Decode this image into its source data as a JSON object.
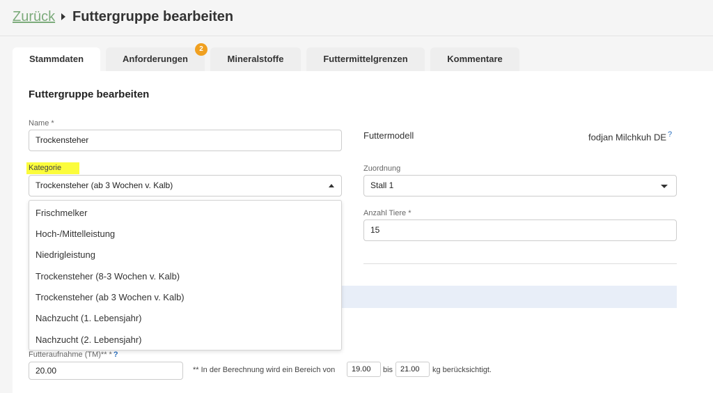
{
  "header": {
    "back_label": "Zurück",
    "title": "Futtergruppe bearbeiten"
  },
  "tabs": [
    {
      "label": "Stammdaten",
      "active": true
    },
    {
      "label": "Anforderungen",
      "badge": "2"
    },
    {
      "label": "Mineralstoffe"
    },
    {
      "label": "Futtermittelgrenzen"
    },
    {
      "label": "Kommentare"
    }
  ],
  "form": {
    "section_title": "Futtergruppe bearbeiten",
    "name_label": "Name *",
    "name_value": "Trockensteher",
    "futtermodell_label": "Futtermodell",
    "futtermodell_value": "fodjan Milchkuh DE",
    "help_mark": "?",
    "kategorie_label": "Kategorie",
    "kategorie_value": "Trockensteher (ab 3 Wochen v. Kalb)",
    "zuordnung_label": "Zuordnung",
    "zuordnung_value": "Stall 1",
    "anzahl_label": "Anzahl Tiere *",
    "anzahl_value": "15",
    "futteraufnahme_label": "Futteraufnahme (TM)** *",
    "futteraufnahme_value": "20.00",
    "range_note_prefix": "** In der Berechnung wird ein Bereich von",
    "range_from": "19.00",
    "range_mid": "bis",
    "range_to": "21.00",
    "range_suffix": "kg berücksichtigt."
  },
  "kategorie_options": [
    "Frischmelker",
    "Hoch-/Mittelleistung",
    "Niedrigleistung",
    "Trockensteher (8-3 Wochen v. Kalb)",
    "Trockensteher (ab 3 Wochen v. Kalb)",
    "Nachzucht (1. Lebensjahr)",
    "Nachzucht (2. Lebensjahr)"
  ],
  "colors": {
    "accent_green": "#7cab7b",
    "badge_orange": "#f0a020",
    "highlight_yellow": "#fbfc3c",
    "info_blue": "#e8eef8"
  }
}
